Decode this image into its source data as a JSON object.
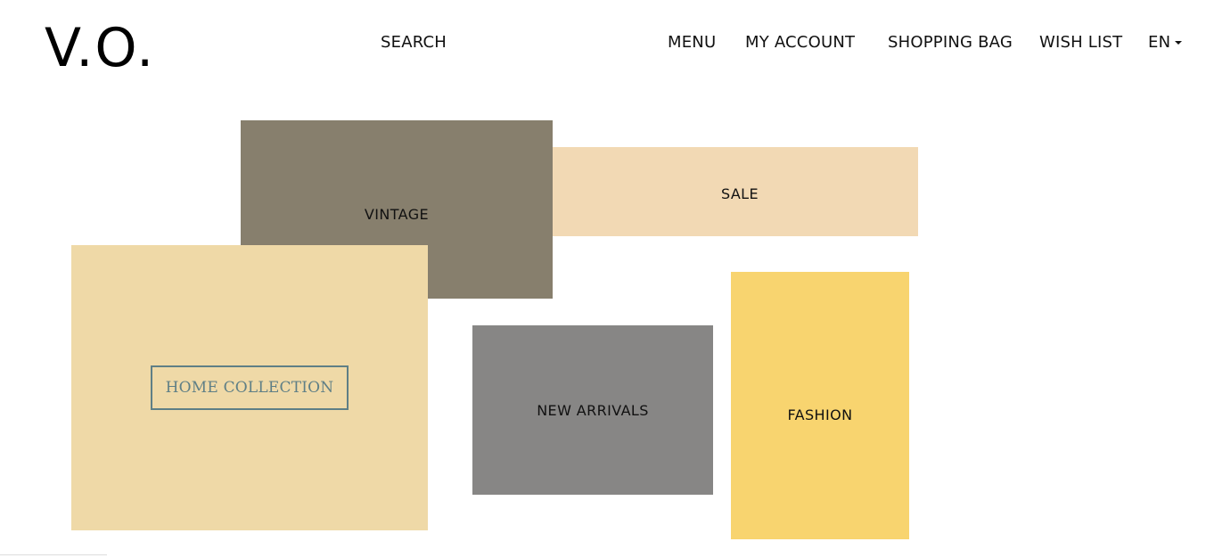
{
  "header": {
    "logo": "V.O.",
    "nav": {
      "search": "SEARCH",
      "menu": "MENU",
      "account": "MY ACCOUNT",
      "shopping_bag": "SHOPPING BAG",
      "wish_list": "WISH LIST",
      "language": "EN"
    }
  },
  "tiles": {
    "vintage": {
      "label": "VINTAGE",
      "color": "#877f6d"
    },
    "sale": {
      "label": "SALE",
      "color": "#f2d9b4"
    },
    "home_collection": {
      "label": "HOME COLLECTION",
      "color": "#efd9a7",
      "border_color": "#5f7f86"
    },
    "new_arrivals": {
      "label": "NEW ARRIVALS",
      "color": "#878685"
    },
    "fashion": {
      "label": "FASHION",
      "color": "#f8d46f"
    }
  },
  "icons": {
    "language_dropdown": "caret-down-icon"
  }
}
